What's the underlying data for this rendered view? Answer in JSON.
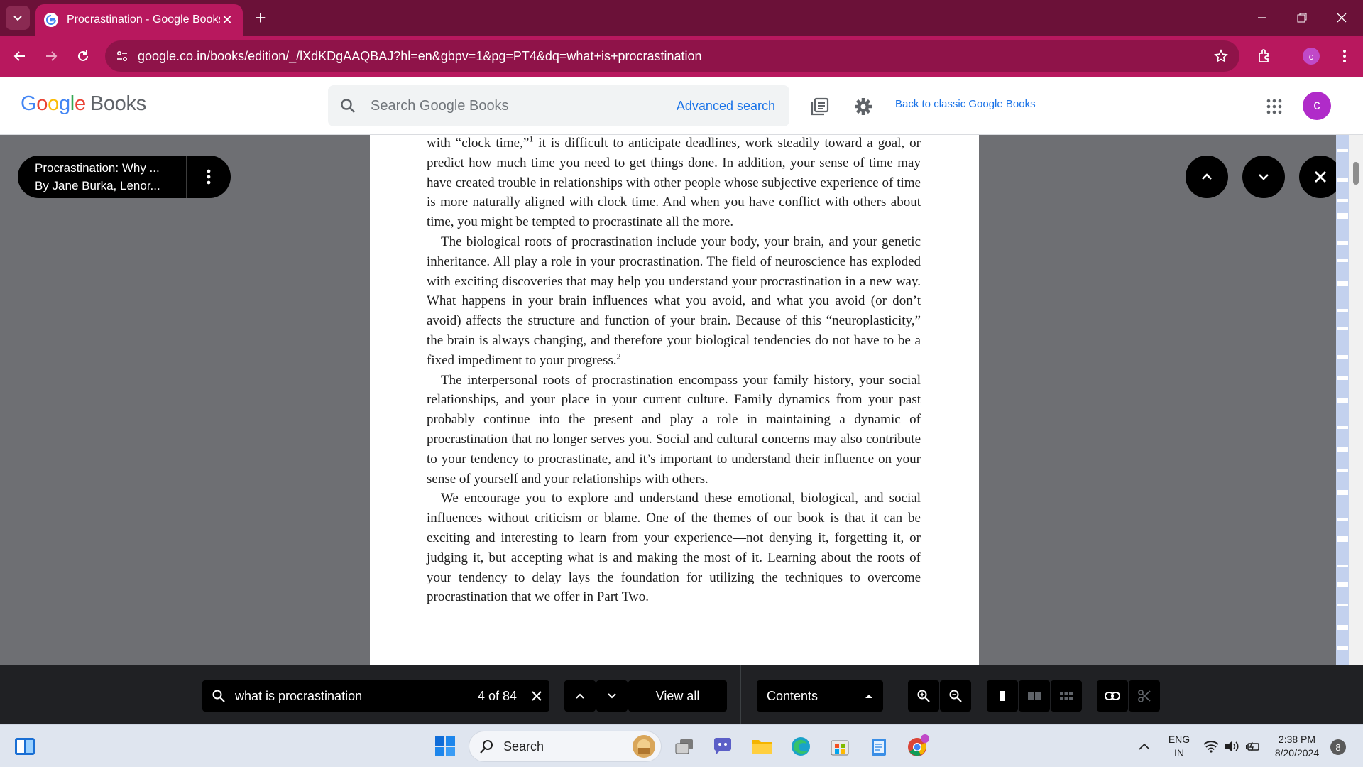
{
  "browser": {
    "tab_title": "Procrastination - Google Books",
    "url": "google.co.in/books/edition/_/lXdKDgAAQBAJ?hl=en&gbpv=1&pg=PT4&dq=what+is+procrastination",
    "profile_initial": "c"
  },
  "gb_header": {
    "logo_letters": [
      "G",
      "o",
      "o",
      "g",
      "l",
      "e"
    ],
    "logo_suffix": "Books",
    "search_placeholder": "Search Google Books",
    "advanced_search": "Advanced search",
    "classic_link": "Back to classic Google Books",
    "avatar_initial": "c"
  },
  "book_info": {
    "title": "Procrastination: Why ...",
    "authors": "By Jane Burka, Lenor..."
  },
  "page": {
    "p1_a": "with “clock time,”",
    "p1_sup": "1",
    "p1_b": " it is difficult to anticipate deadlines, work steadily toward a goal, or predict how much time you need to get things done. In addition, your sense of time may have created trouble in relationships with other people whose subjective experience of time is more naturally aligned with clock time. And when you have conflict with others about time, you might be tempted to procrastinate all the more.",
    "p2_a": "The biological roots of procrastination include your body, your brain, and your genetic inheritance. All play a role in your procrastination. The field of neuroscience has exploded with exciting discoveries that may help you understand your procrastination in a new way. What happens in your brain influences what you avoid, and what you avoid (or don’t avoid) affects the structure and function of your brain. Because of this “neuroplasticity,” the brain is always changing, and therefore your biological tendencies do not have to be a fixed impediment to your progress.",
    "p2_sup": "2",
    "p3": "The interpersonal roots of procrastination encompass your family history, your social relationships, and your place in your current culture. Family dynamics from your past probably continue into the present and play a role in maintaining a dynamic of procrastination that no longer serves you. Social and cultural concerns may also contribute to your tendency to procrastinate, and it’s important to understand their influence on your sense of yourself and your relationships with others.",
    "p4": "We encourage you to explore and understand these emotional, biological, and social influences without criticism or blame. One of the themes of our book is that it can be exciting and interesting to learn from your experience—not denying it, forgetting it, or judging it, but accepting what is and making the most of it. Learning about the roots of your tendency to delay lays the foundation for utilizing the techniques to overcome procrastination that we offer in Part Two."
  },
  "toolbar": {
    "search_query": "what is procrastination",
    "match_count": "4 of 84",
    "view_all": "View all",
    "contents": "Contents"
  },
  "taskbar": {
    "search_label": "Search",
    "lang_top": "ENG",
    "lang_bottom": "IN",
    "time": "2:38 PM",
    "date": "8/20/2024",
    "notification_count": "8"
  },
  "colors": {
    "tabbar": "#6b1138",
    "addressbar": "#b8185e",
    "link": "#1a73e8",
    "avatar": "#b02bc9"
  }
}
